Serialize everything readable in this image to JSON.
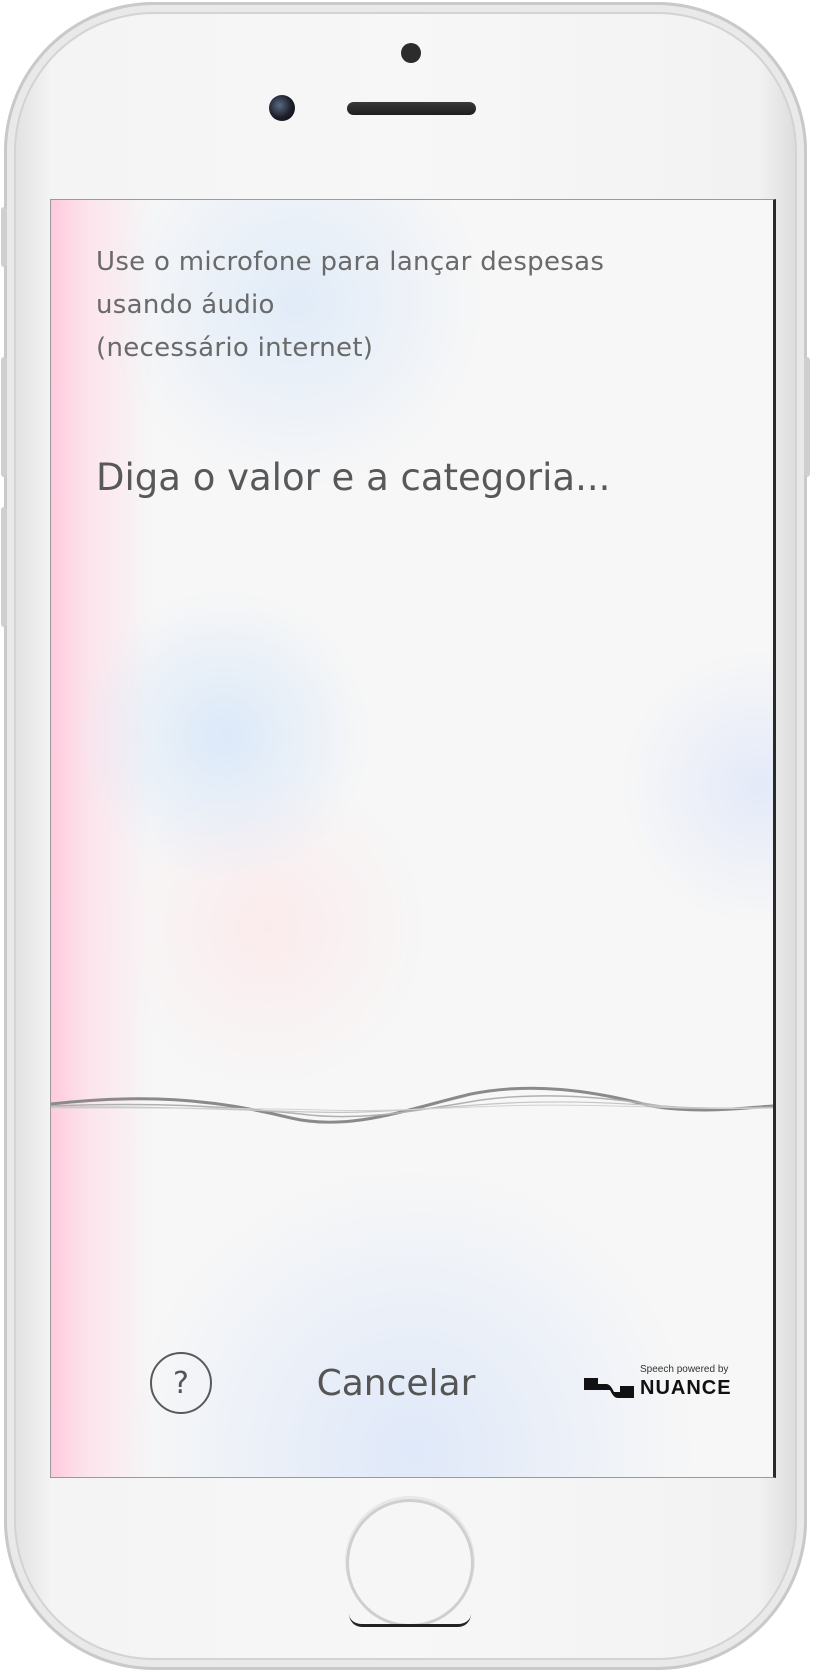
{
  "app": {
    "instructions_lines": [
      "Use o microfone para lançar despesas",
      "usando áudio",
      "(necessário internet)"
    ],
    "prompt": "Diga o valor e a categoria..."
  },
  "footer": {
    "help_label": "?",
    "cancel_label": "Cancelar",
    "nuance_caption": "Speech powered by",
    "nuance_brand": "NUANCE"
  },
  "icons": {
    "help": "help-circle-icon",
    "waveform": "voice-waveform-icon",
    "nuance": "nuance-logo-icon"
  },
  "colors": {
    "text_primary": "#585858",
    "text_secondary": "#6a6a6a",
    "waveform": "#7a7a7a",
    "accent_pink": "#ffc8dc",
    "accent_blue": "#d2e4fa"
  }
}
